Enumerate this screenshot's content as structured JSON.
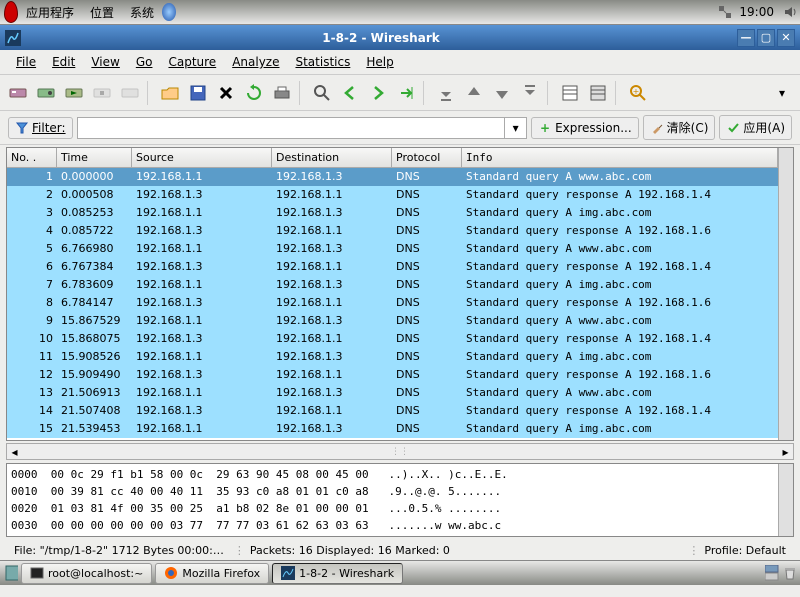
{
  "top_panel": {
    "menus": [
      "应用程序",
      "位置",
      "系统"
    ],
    "time": "19:00"
  },
  "window": {
    "title": "1-8-2 - Wireshark"
  },
  "menubar": [
    "File",
    "Edit",
    "View",
    "Go",
    "Capture",
    "Analyze",
    "Statistics",
    "Help"
  ],
  "filterbar": {
    "label": "Filter:",
    "expression": "Expression...",
    "clear": "清除(C)",
    "apply": "应用(A)"
  },
  "columns": {
    "no": "No. .",
    "time": "Time",
    "source": "Source",
    "destination": "Destination",
    "protocol": "Protocol",
    "info": "Info"
  },
  "packets": [
    {
      "no": "1",
      "time": "0.000000",
      "src": "192.168.1.1",
      "dst": "192.168.1.3",
      "proto": "DNS",
      "info": "Standard query A www.abc.com",
      "selected": true
    },
    {
      "no": "2",
      "time": "0.000508",
      "src": "192.168.1.3",
      "dst": "192.168.1.1",
      "proto": "DNS",
      "info": "Standard query response A 192.168.1.4"
    },
    {
      "no": "3",
      "time": "0.085253",
      "src": "192.168.1.1",
      "dst": "192.168.1.3",
      "proto": "DNS",
      "info": "Standard query A img.abc.com"
    },
    {
      "no": "4",
      "time": "0.085722",
      "src": "192.168.1.3",
      "dst": "192.168.1.1",
      "proto": "DNS",
      "info": "Standard query response A 192.168.1.6"
    },
    {
      "no": "5",
      "time": "6.766980",
      "src": "192.168.1.1",
      "dst": "192.168.1.3",
      "proto": "DNS",
      "info": "Standard query A www.abc.com"
    },
    {
      "no": "6",
      "time": "6.767384",
      "src": "192.168.1.3",
      "dst": "192.168.1.1",
      "proto": "DNS",
      "info": "Standard query response A 192.168.1.4"
    },
    {
      "no": "7",
      "time": "6.783609",
      "src": "192.168.1.1",
      "dst": "192.168.1.3",
      "proto": "DNS",
      "info": "Standard query A img.abc.com"
    },
    {
      "no": "8",
      "time": "6.784147",
      "src": "192.168.1.3",
      "dst": "192.168.1.1",
      "proto": "DNS",
      "info": "Standard query response A 192.168.1.6"
    },
    {
      "no": "9",
      "time": "15.867529",
      "src": "192.168.1.1",
      "dst": "192.168.1.3",
      "proto": "DNS",
      "info": "Standard query A www.abc.com"
    },
    {
      "no": "10",
      "time": "15.868075",
      "src": "192.168.1.3",
      "dst": "192.168.1.1",
      "proto": "DNS",
      "info": "Standard query response A 192.168.1.4"
    },
    {
      "no": "11",
      "time": "15.908526",
      "src": "192.168.1.1",
      "dst": "192.168.1.3",
      "proto": "DNS",
      "info": "Standard query A img.abc.com"
    },
    {
      "no": "12",
      "time": "15.909490",
      "src": "192.168.1.3",
      "dst": "192.168.1.1",
      "proto": "DNS",
      "info": "Standard query response A 192.168.1.6"
    },
    {
      "no": "13",
      "time": "21.506913",
      "src": "192.168.1.1",
      "dst": "192.168.1.3",
      "proto": "DNS",
      "info": "Standard query A www.abc.com"
    },
    {
      "no": "14",
      "time": "21.507408",
      "src": "192.168.1.3",
      "dst": "192.168.1.1",
      "proto": "DNS",
      "info": "Standard query response A 192.168.1.4"
    },
    {
      "no": "15",
      "time": "21.539453",
      "src": "192.168.1.1",
      "dst": "192.168.1.3",
      "proto": "DNS",
      "info": "Standard query A img.abc.com"
    }
  ],
  "hexdump": "0000  00 0c 29 f1 b1 58 00 0c  29 63 90 45 08 00 45 00   ..)..X.. )c..E..E.\n0010  00 39 81 cc 40 00 40 11  35 93 c0 a8 01 01 c0 a8   .9..@.@. 5.......\n0020  01 03 81 4f 00 35 00 25  a1 b8 02 8e 01 00 00 01   ...0.5.% ........\n0030  00 00 00 00 00 00 03 77  77 77 03 61 62 63 03 63   .......w ww.abc.c",
  "statusbar": {
    "file": "File: \"/tmp/1-8-2\" 1712 Bytes 00:00:…",
    "packets": "Packets: 16 Displayed: 16 Marked: 0",
    "profile": "Profile: Default"
  },
  "taskbar": {
    "terminal": "root@localhost:~",
    "firefox": "Mozilla Firefox",
    "wireshark": "1-8-2 - Wireshark"
  }
}
